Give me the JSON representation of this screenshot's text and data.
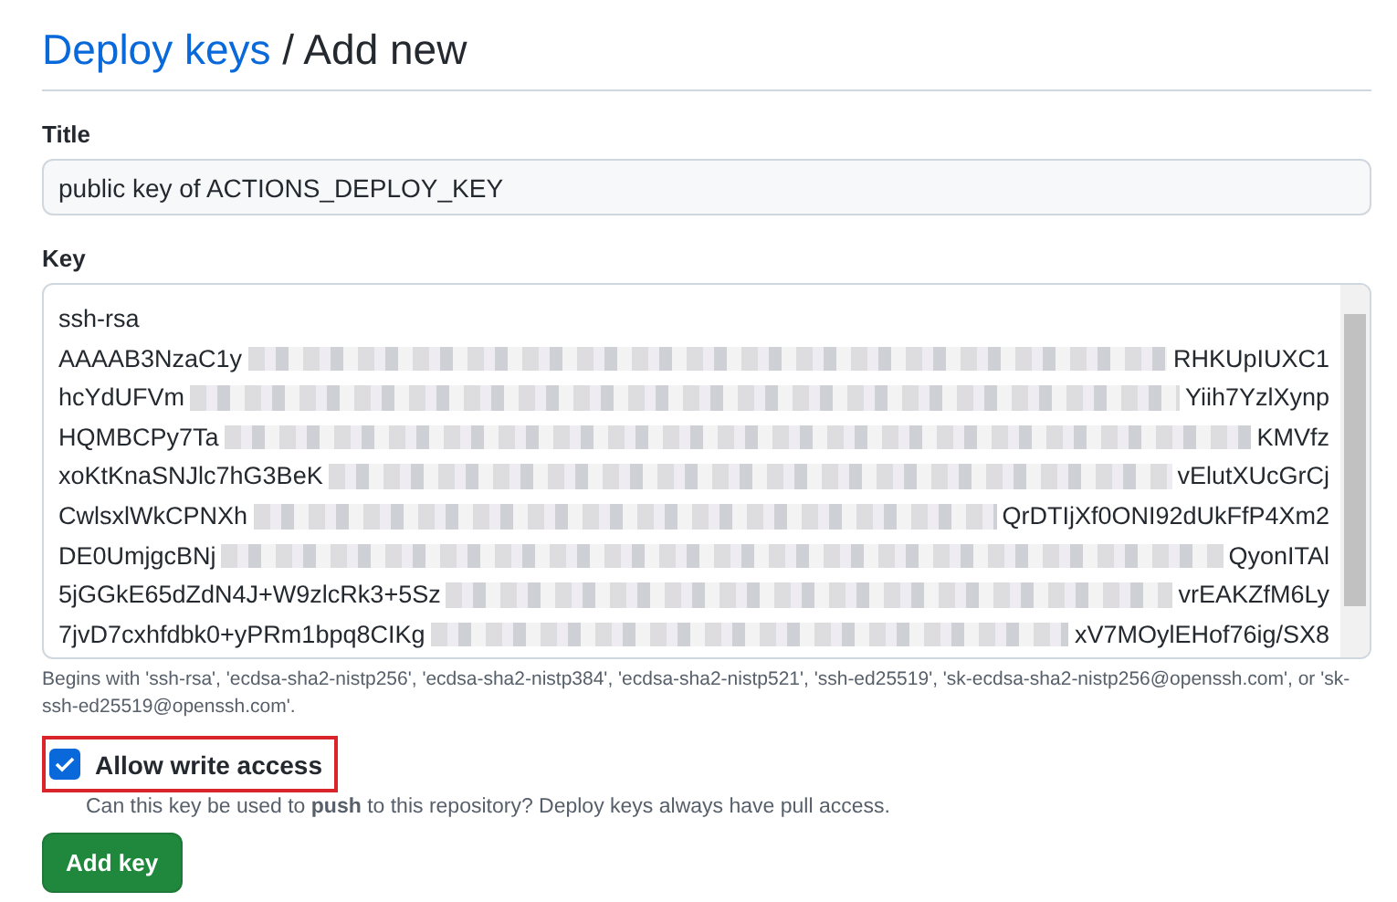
{
  "heading": {
    "link": "Deploy keys",
    "rest": " / Add new"
  },
  "title_field": {
    "label": "Title",
    "value": "public key of ACTIONS_DEPLOY_KEY"
  },
  "key_field": {
    "label": "Key",
    "lines": [
      {
        "left": "ssh-rsa"
      },
      {
        "left": "AAAAB3NzaC1y",
        "right": "RHKUpIUXC1"
      },
      {
        "left": "hcYdUFVm",
        "right": "Yiih7YzlXynp"
      },
      {
        "left": "HQMBCPy7Ta",
        "right": "KMVfz"
      },
      {
        "left": "xoKtKnaSNJlc7hG3BeK",
        "right": "vElutXUcGrCj"
      },
      {
        "left": "CwlsxlWkCPNXh",
        "right": "QrDTIjXf0ONI92dUkFfP4Xm2"
      },
      {
        "left": "DE0UmjgcBNj",
        "right": "QyonITAl"
      },
      {
        "left": "5jGGkE65dZdN4J+W9zlcRk3+5Sz",
        "right": "vrEAKZfM6Ly"
      },
      {
        "left": "7jvD7cxhfdbk0+yPRm1bpq8CIKg",
        "right": "xV7MOylEHof76ig/SX8"
      }
    ],
    "help": "Begins with 'ssh-rsa', 'ecdsa-sha2-nistp256', 'ecdsa-sha2-nistp384', 'ecdsa-sha2-nistp521', 'ssh-ed25519', 'sk-ecdsa-sha2-nistp256@openssh.com', or 'sk-ssh-ed25519@openssh.com'."
  },
  "write_access": {
    "label": "Allow write access",
    "checked": true,
    "highlighted": true,
    "hint": "Can this key be used to **push** to this repository? Deploy keys always have pull access."
  },
  "submit": "Add key"
}
